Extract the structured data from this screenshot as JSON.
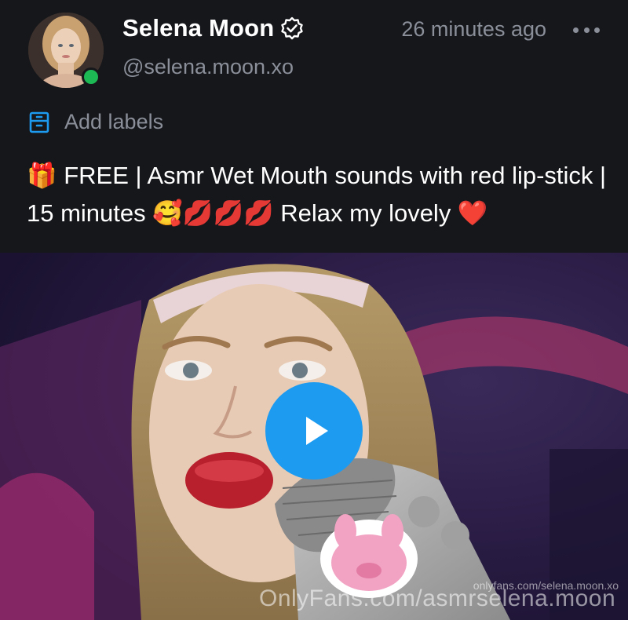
{
  "post": {
    "author": {
      "display_name": "Selena Moon",
      "handle": "@selena.moon.xo",
      "verified": true,
      "online": true,
      "avatar_icon": "avatar-photo"
    },
    "timestamp": "26 minutes ago",
    "more_icon": "more-horizontal-icon",
    "labels": {
      "icon": "label-icon",
      "text": "Add labels"
    },
    "caption": "🎁 FREE | Asmr Wet Mouth sounds with red lip-stick | 15 minutes 🥰💋💋💋 Relax my lovely ❤️",
    "media": {
      "type": "video",
      "play_icon": "play-icon",
      "watermark": "OnlyFans.com/asmrselena.moon",
      "watermark_small": "onlyfans.com/selena.moon.xo"
    }
  },
  "colors": {
    "background": "#16171b",
    "muted_text": "#8a8f99",
    "accent": "#1d9bf0",
    "online": "#1db954"
  }
}
